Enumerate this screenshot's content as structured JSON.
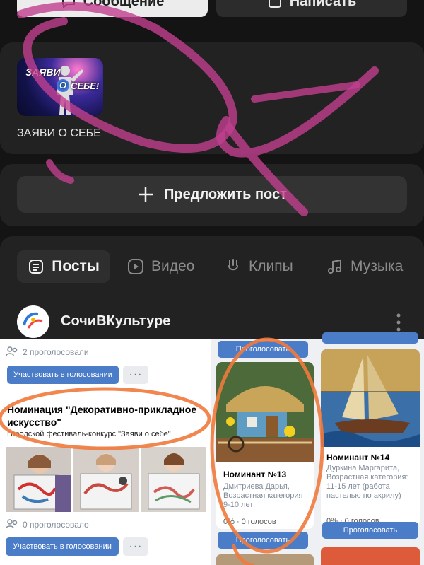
{
  "top": {
    "message_label": "Сообщение",
    "write_label": "Написать"
  },
  "community_card": {
    "cover_title": "ЗАЯВИ О СЕБЕ",
    "cover_text_1": "ЗАЯВИ",
    "cover_text_2": "О",
    "cover_text_3": "СЕБЕ!"
  },
  "suggest_post": {
    "label": "Предложить пост"
  },
  "tabs": [
    {
      "label": "Посты",
      "icon": "posts-icon",
      "active": true
    },
    {
      "label": "Видео",
      "icon": "video-icon"
    },
    {
      "label": "Клипы",
      "icon": "clips-icon"
    },
    {
      "label": "Музыка",
      "icon": "music-icon"
    }
  ],
  "group": {
    "name": "СочиВКультуре",
    "avatar_caption": "СочиВКультуре"
  },
  "poll_top": {
    "voters": "2 проголосовали",
    "button": "Участвовать в голосовании",
    "more": "···"
  },
  "post": {
    "title": "Номинация \"Декоративно-прикладное искусство\"",
    "subtitle": "Городской фестиваль-конкурс \"Заяви о себе\""
  },
  "poll_bottom": {
    "voters": "0 проголосовало",
    "button": "Участвовать в голосовании",
    "more": "···"
  },
  "nominee_13": {
    "title": "Номинант №13",
    "desc": "Дмитриева Дарья, Возрастная категория 9-10 лет",
    "result": "0% · 0 голосов",
    "vote": "Проголосовать"
  },
  "nominee_14": {
    "title": "Номинант №14",
    "desc": "Дуркина Маргарита, Возрастная категория: 11-15 лет (работа пастелью по акрилу)",
    "result": "0% · 0 голосов",
    "vote": "Проголосовать"
  },
  "prev_vote": "Проголосовать",
  "colors": {
    "accent": "#4a7cc7",
    "annotation_pink": "#c2408f",
    "annotation_orange": "#f07a3c"
  }
}
